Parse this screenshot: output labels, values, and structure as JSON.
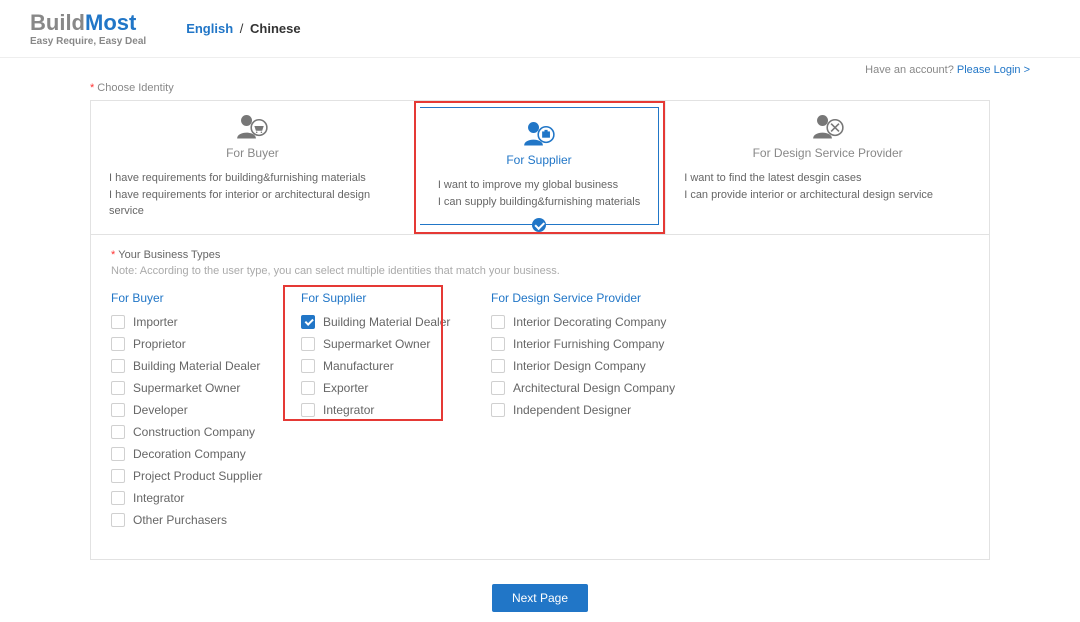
{
  "header": {
    "logo_main_1": "Build",
    "logo_main_2": "Most",
    "logo_sub": "Easy Require, Easy Deal",
    "lang_en": "English",
    "lang_sep": "/",
    "lang_cn": "Chinese"
  },
  "topright": {
    "have": "Have an account? ",
    "login": "Please Login >"
  },
  "identity": {
    "label": "Choose Identity",
    "cards": {
      "buyer": {
        "title": "For Buyer",
        "line1": "I have requirements for building&furnishing materials",
        "line2": "I have requirements for interior or architectural design service"
      },
      "supplier": {
        "title": "For Supplier",
        "line1": "I want to improve my global business",
        "line2": "I can supply building&furnishing materials"
      },
      "design": {
        "title": "For Design Service Provider",
        "line1": "I want to find the latest desgin cases",
        "line2": "I can provide interior or architectural design service"
      }
    }
  },
  "biz": {
    "label": "Your Business Types",
    "note": "Note: According to the user type, you can select multiple identities that match your business.",
    "colBuyer": {
      "title": "For Buyer",
      "items": [
        "Importer",
        "Proprietor",
        "Building Material Dealer",
        "Supermarket Owner",
        "Developer",
        "Construction Company",
        "Decoration Company",
        "Project Product Supplier",
        "Integrator",
        "Other Purchasers"
      ]
    },
    "colSupplier": {
      "title": "For Supplier",
      "items": [
        "Building Material Dealer",
        "Supermarket Owner",
        "Manufacturer",
        "Exporter",
        "Integrator"
      ],
      "checked": [
        true,
        false,
        false,
        false,
        false
      ]
    },
    "colDesign": {
      "title": "For Design Service Provider",
      "items": [
        "Interior Decorating Company",
        "Interior Furnishing Company",
        "Interior Design Company",
        "Architectural Design Company",
        "Independent Designer"
      ]
    }
  },
  "footer": {
    "next": "Next Page"
  }
}
